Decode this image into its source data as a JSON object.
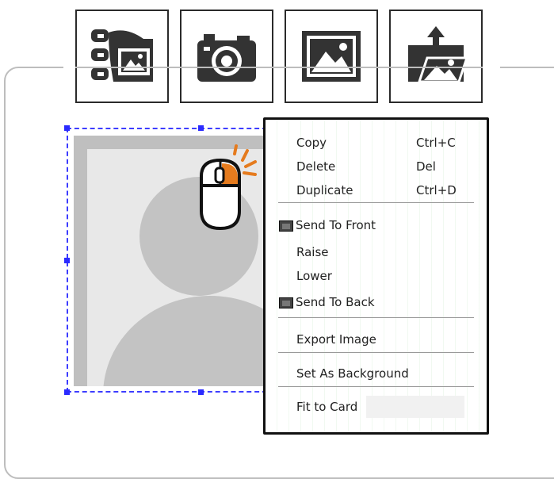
{
  "toolbar": {
    "buttons": [
      {
        "icon": "layers-image-icon"
      },
      {
        "icon": "camera-icon"
      },
      {
        "icon": "picture-icon"
      },
      {
        "icon": "image-upload-icon"
      }
    ]
  },
  "colors": {
    "icon": "#333333",
    "selection": "#2b2bff",
    "mouse_button": "#e57b1e",
    "panel_border": "#bdbdbd"
  },
  "context_menu": {
    "items": [
      {
        "label": "Copy",
        "shortcut": "Ctrl+C"
      },
      {
        "label": "Delete",
        "shortcut": "Del"
      },
      {
        "label": "Duplicate",
        "shortcut": "Ctrl+D"
      },
      {
        "label": "Send To Front",
        "icon": "layer-front-icon"
      },
      {
        "label": "Raise"
      },
      {
        "label": "Lower"
      },
      {
        "label": "Send To Back",
        "icon": "layer-back-icon"
      },
      {
        "label": "Export Image"
      },
      {
        "label": "Set As Background"
      },
      {
        "label": "Fit to Card"
      }
    ]
  }
}
